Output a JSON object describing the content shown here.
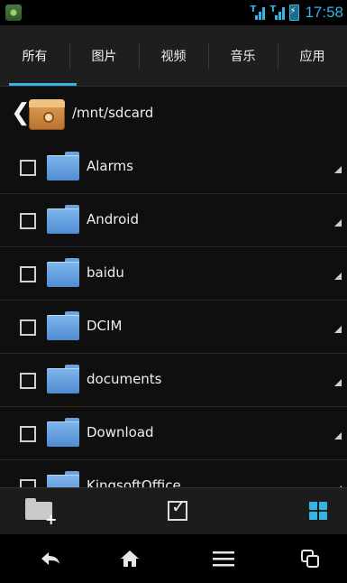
{
  "status_bar": {
    "time": "17:58",
    "colors": {
      "accent": "#33b5e5"
    }
  },
  "tabs": [
    {
      "label": "所有",
      "active": true
    },
    {
      "label": "图片",
      "active": false
    },
    {
      "label": "视频",
      "active": false
    },
    {
      "label": "音乐",
      "active": false
    },
    {
      "label": "应用",
      "active": false
    }
  ],
  "path": {
    "text": "/mnt/sdcard",
    "icon": "sdcard-icon",
    "back_icon": "chevron-left-icon"
  },
  "files": [
    {
      "name": "Alarms",
      "checked": false
    },
    {
      "name": "Android",
      "checked": false
    },
    {
      "name": "baidu",
      "checked": false
    },
    {
      "name": "DCIM",
      "checked": false
    },
    {
      "name": "documents",
      "checked": false
    },
    {
      "name": "Download",
      "checked": false
    },
    {
      "name": "KingsoftOffice",
      "checked": false
    }
  ],
  "action_bar": {
    "new_folder_icon": "new-folder-icon",
    "select_icon": "checkbox-icon",
    "view_icon": "grid-view-icon"
  },
  "nav_bar": {
    "back": "↩",
    "home": "⌂",
    "menu": "☰",
    "recent": "⧉"
  }
}
